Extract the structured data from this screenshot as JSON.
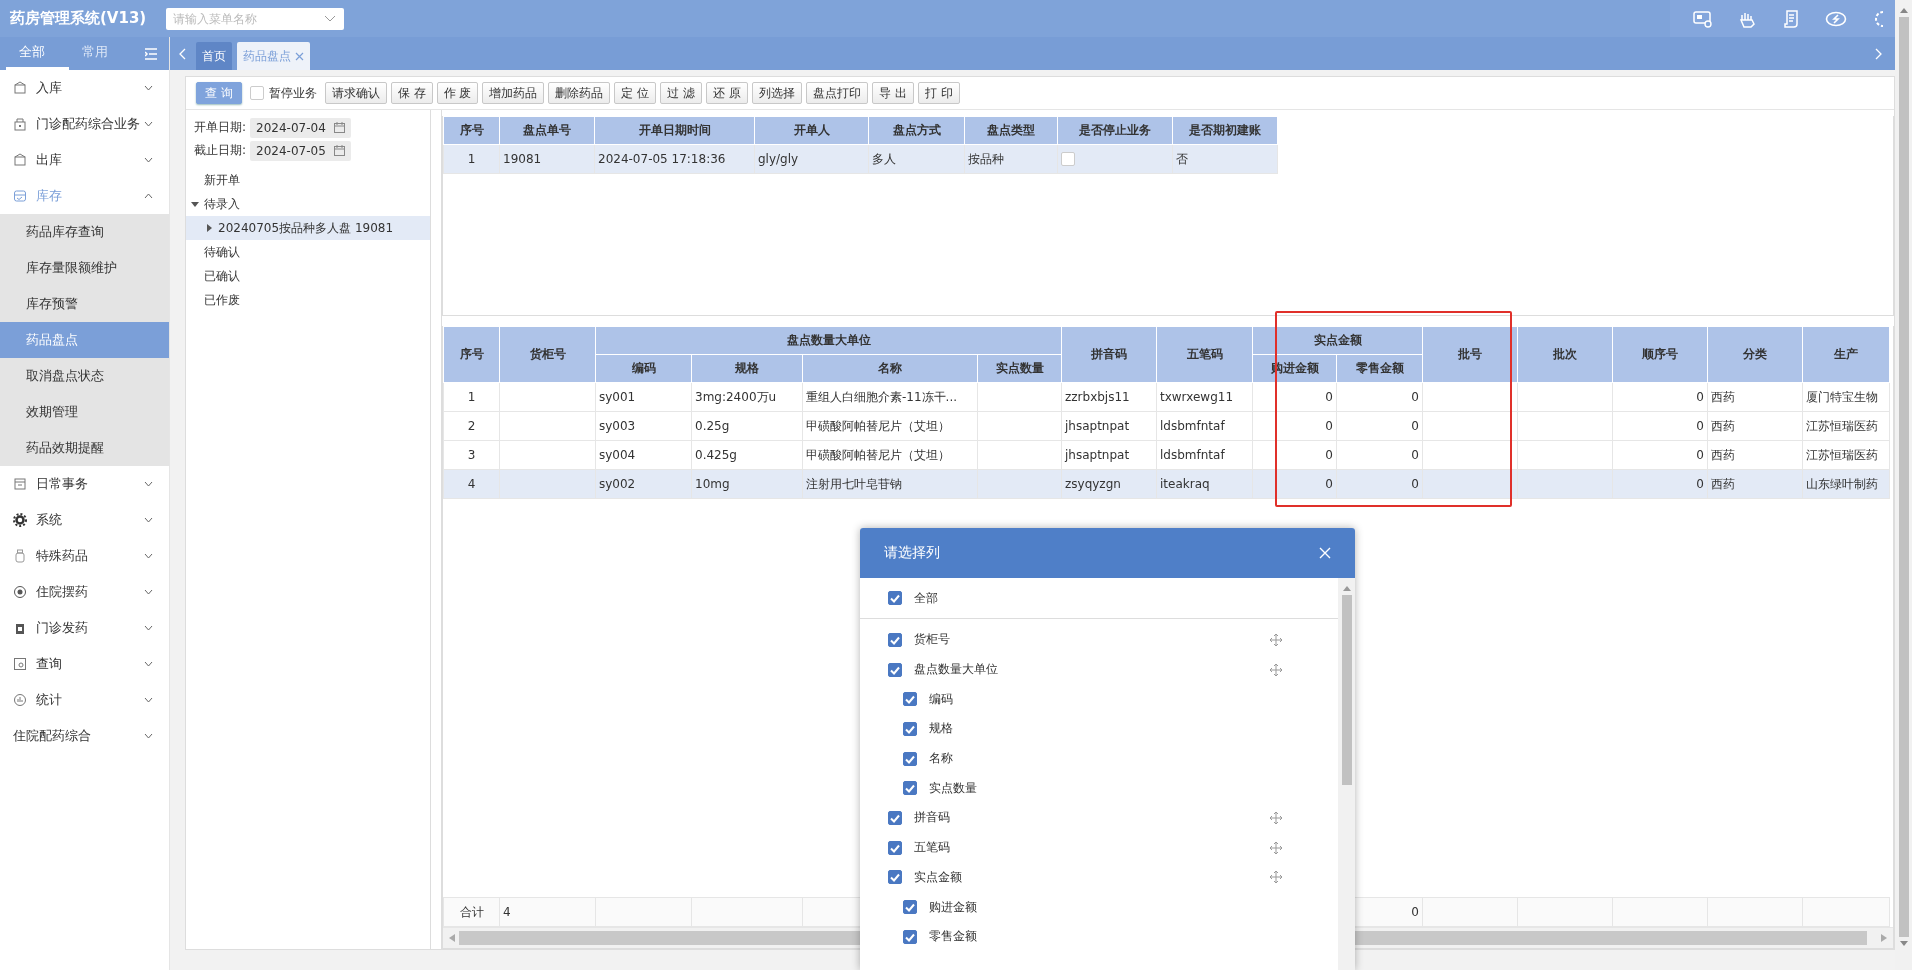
{
  "app": {
    "title": "药房管理系统(V13)",
    "menu_search": {
      "placeholder": "请输入菜单名称"
    }
  },
  "sidebar": {
    "tabs": [
      {
        "label": "全部",
        "selected": true
      },
      {
        "label": "常用",
        "selected": false
      }
    ],
    "items": [
      {
        "label": "入库",
        "expanded": false
      },
      {
        "label": "门诊配药综合业务",
        "expanded": false
      },
      {
        "label": "出库",
        "expanded": false
      },
      {
        "label": "库存",
        "expanded": true,
        "children": [
          {
            "label": "药品库存查询",
            "selected": false
          },
          {
            "label": "库存量限额维护",
            "selected": false
          },
          {
            "label": "库存预警",
            "selected": false
          },
          {
            "label": "药品盘点",
            "selected": true
          },
          {
            "label": "取消盘点状态",
            "selected": false
          },
          {
            "label": "效期管理",
            "selected": false
          },
          {
            "label": "药品效期提醒",
            "selected": false
          }
        ]
      },
      {
        "label": "日常事务",
        "expanded": false
      },
      {
        "label": "系统",
        "expanded": false
      },
      {
        "label": "特殊药品",
        "expanded": false
      },
      {
        "label": "住院摆药",
        "expanded": false
      },
      {
        "label": "门诊发药",
        "expanded": false
      },
      {
        "label": "查询",
        "expanded": false
      },
      {
        "label": "统计",
        "expanded": false
      },
      {
        "label": "住院配药综合",
        "expanded": false
      }
    ]
  },
  "tabs": [
    {
      "label": "首页",
      "selected": false,
      "closable": false
    },
    {
      "label": "药品盘点",
      "selected": true,
      "closable": true
    }
  ],
  "toolbar": [
    {
      "kind": "primary",
      "label": "查 询"
    },
    {
      "kind": "checkbox",
      "label": "暂停业务",
      "checked": false
    },
    {
      "kind": "button",
      "label": "请求确认"
    },
    {
      "kind": "button",
      "label": "保 存"
    },
    {
      "kind": "button",
      "label": "作 废"
    },
    {
      "kind": "button",
      "label": "增加药品"
    },
    {
      "kind": "button",
      "label": "删除药品"
    },
    {
      "kind": "button",
      "label": "定 位"
    },
    {
      "kind": "button",
      "label": "过 滤"
    },
    {
      "kind": "button",
      "label": "还 原"
    },
    {
      "kind": "button",
      "label": "列选择"
    },
    {
      "kind": "button",
      "label": "盘点打印"
    },
    {
      "kind": "button",
      "label": "导 出"
    },
    {
      "kind": "button",
      "label": "打 印"
    }
  ],
  "filters": [
    {
      "label": "开单日期:",
      "value": "2024-07-04"
    },
    {
      "label": "截止日期:",
      "value": "2024-07-05"
    }
  ],
  "tree": [
    {
      "label": "新开单",
      "selected": false
    },
    {
      "label": "待录入",
      "selected": false,
      "expanded": true,
      "children": [
        {
          "label": "20240705按品种多人盘 19081",
          "selected": true,
          "expanded": false
        }
      ]
    },
    {
      "label": "待确认",
      "selected": false
    },
    {
      "label": "已确认",
      "selected": false
    },
    {
      "label": "已作废",
      "selected": false
    }
  ],
  "orders_table": {
    "columns": [
      {
        "label": "序号"
      },
      {
        "label": "盘点单号"
      },
      {
        "label": "开单日期时间"
      },
      {
        "label": "开单人"
      },
      {
        "label": "盘点方式"
      },
      {
        "label": "盘点类型"
      },
      {
        "label": "是否停止业务"
      },
      {
        "label": "是否期初建账"
      }
    ],
    "rows": [
      {
        "selected": true,
        "cells": [
          "1",
          "19081",
          "2024-07-05 17:18:36",
          "gly/gly",
          "多人",
          "按品种",
          {
            "kind": "checkbox",
            "checked": false
          },
          "否"
        ]
      }
    ]
  },
  "items_table": {
    "columns": [
      {
        "label": "序号"
      },
      {
        "label": "货柜号"
      },
      {
        "label": "盘点数量大单位",
        "colspan": 4,
        "children": [
          {
            "label": "编码"
          },
          {
            "label": "规格"
          },
          {
            "label": "名称"
          },
          {
            "label": "实点数量"
          }
        ]
      },
      {
        "label": "拼音码"
      },
      {
        "label": "五笔码"
      },
      {
        "label": "实点金额",
        "colspan": 2,
        "children": [
          {
            "label": "购进金额"
          },
          {
            "label": "零售金额"
          }
        ]
      },
      {
        "label": "批号"
      },
      {
        "label": "批次"
      },
      {
        "label": "顺序号"
      },
      {
        "label": "分类"
      },
      {
        "label": "生产"
      }
    ],
    "rows": [
      {
        "selected": false,
        "cells": [
          "1",
          null,
          "sy001",
          "3mg:2400万u",
          "重组人白细胞介素-11冻干...",
          null,
          "zzrbxbjs11",
          "txwrxewg11",
          "0",
          "0",
          null,
          null,
          "0",
          "西药",
          "厦门特宝生物"
        ]
      },
      {
        "selected": false,
        "cells": [
          "2",
          null,
          "sy003",
          "0.25g",
          "甲磺酸阿帕替尼片（艾坦）",
          null,
          "jhsaptnpat",
          "ldsbmfntaf",
          "0",
          "0",
          null,
          null,
          "0",
          "西药",
          "江苏恒瑞医药"
        ]
      },
      {
        "selected": false,
        "cells": [
          "3",
          null,
          "sy004",
          "0.425g",
          "甲磺酸阿帕替尼片（艾坦）",
          null,
          "jhsaptnpat",
          "ldsbmfntaf",
          "0",
          "0",
          null,
          null,
          "0",
          "西药",
          "江苏恒瑞医药"
        ]
      },
      {
        "selected": true,
        "cells": [
          "4",
          null,
          "sy002",
          "10mg",
          "注射用七叶皂苷钠",
          null,
          "zsyqyzgn",
          "iteakraq",
          "0",
          "0",
          null,
          null,
          "0",
          "西药",
          "山东绿叶制药"
        ]
      }
    ],
    "footer": {
      "label": "合计",
      "count": "4",
      "retail_total": "0"
    }
  },
  "column_dialog": {
    "title": "请选择列",
    "select_all": {
      "label": "全部",
      "checked": true
    },
    "columns": [
      {
        "label": "货柜号",
        "checked": true
      },
      {
        "label": "盘点数量大单位",
        "checked": true,
        "children": [
          {
            "label": "编码",
            "checked": true
          },
          {
            "label": "规格",
            "checked": true
          },
          {
            "label": "名称",
            "checked": true
          },
          {
            "label": "实点数量",
            "checked": true
          }
        ]
      },
      {
        "label": "拼音码",
        "checked": true
      },
      {
        "label": "五笔码",
        "checked": true
      },
      {
        "label": "实点金额",
        "checked": true,
        "children": [
          {
            "label": "购进金额",
            "checked": true
          },
          {
            "label": "零售金额",
            "checked": true
          }
        ]
      }
    ]
  }
}
